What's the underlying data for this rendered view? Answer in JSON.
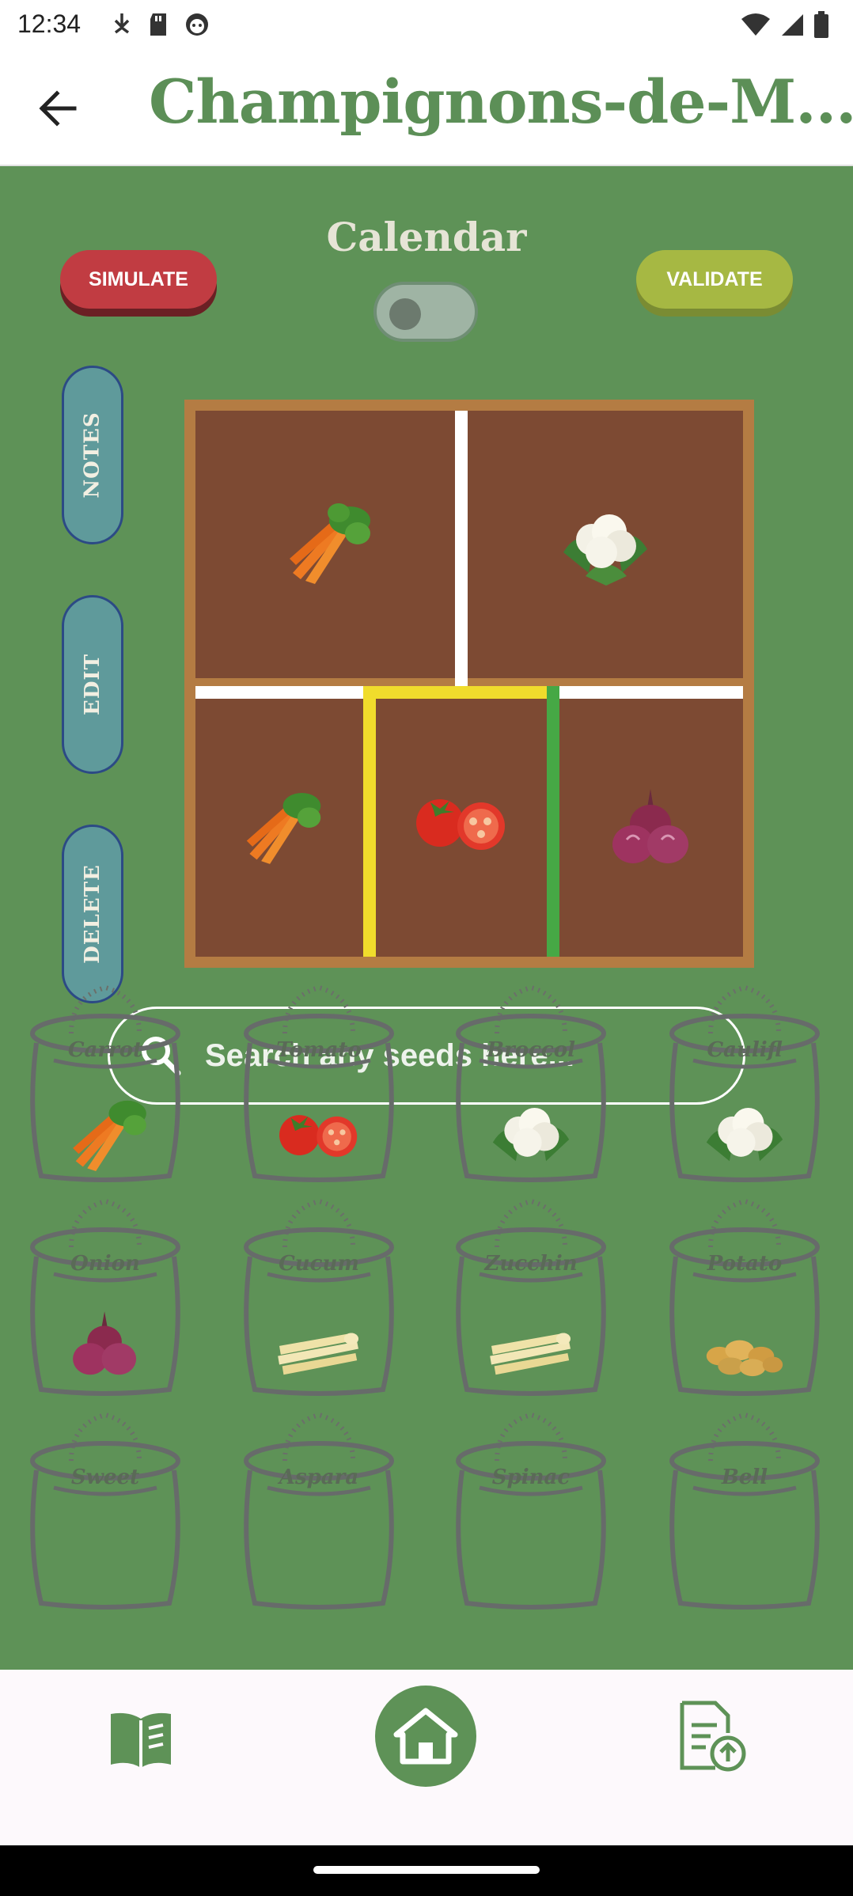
{
  "status_bar": {
    "time": "12:34",
    "left_icons": [
      "download-arrow-icon",
      "sd-card-icon",
      "face-icon"
    ],
    "right_icons": [
      "wifi-icon",
      "signal-icon",
      "battery-icon"
    ]
  },
  "app_bar": {
    "back_icon": "arrow-back-icon",
    "title": "Champignons-de-M..."
  },
  "controls": {
    "calendar_label": "Calendar",
    "calendar_toggle_on": false,
    "simulate_label": "SIMULATE",
    "validate_label": "VALIDATE"
  },
  "side_tabs": [
    {
      "label": "NOTES"
    },
    {
      "label": "EDIT"
    },
    {
      "label": "DELETE"
    }
  ],
  "garden": {
    "plots": [
      {
        "crop": "carrot",
        "selected": false
      },
      {
        "crop": "cauliflower",
        "selected": false
      },
      {
        "crop": "carrot",
        "selected": false
      },
      {
        "crop": "tomato",
        "selected": true
      },
      {
        "crop": "onion",
        "selected": false
      }
    ]
  },
  "search": {
    "placeholder": "Search any seeds here..."
  },
  "seeds": [
    {
      "name": "Carrot",
      "art": "carrot"
    },
    {
      "name": "Tomato",
      "art": "tomato"
    },
    {
      "name": "Broccol",
      "art": "cauliflower"
    },
    {
      "name": "Caulifl",
      "art": "cauliflower"
    },
    {
      "name": "Onion",
      "art": "onion"
    },
    {
      "name": "Cucum",
      "art": "white-asparagus"
    },
    {
      "name": "Zucchin",
      "art": "white-asparagus"
    },
    {
      "name": "Potato",
      "art": "potato"
    },
    {
      "name": "Sweet",
      "art": ""
    },
    {
      "name": "Aspara",
      "art": ""
    },
    {
      "name": "Spinac",
      "art": ""
    },
    {
      "name": "Bell",
      "art": ""
    }
  ],
  "bottom_nav": {
    "items": [
      "book-icon",
      "home-icon",
      "report-upload-icon"
    ],
    "active": "home-icon"
  },
  "colors": {
    "background": "#5e9257",
    "title_green": "#5c8f57",
    "simulate_red": "#c13c42",
    "validate_olive": "#a6b843",
    "soil_brown": "#7d4a33",
    "bed_frame": "#b47c43",
    "tab_teal": "#5f9a9b",
    "selected_yellow": "#f0dc2c",
    "selected_green": "#46a845"
  }
}
